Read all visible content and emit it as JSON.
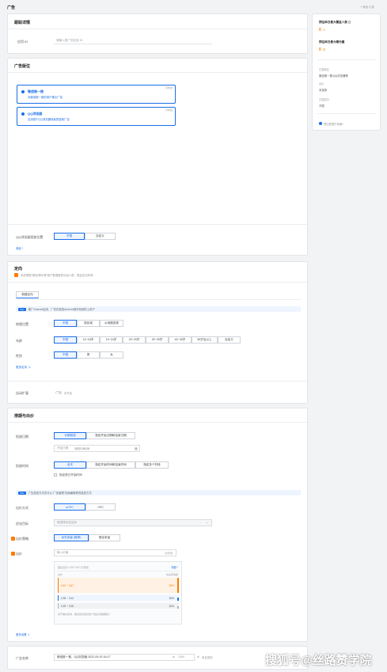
{
  "page": {
    "title": "广告",
    "top_link": "+ 添加 计划"
  },
  "tracking": {
    "header": "跟踪详情",
    "app_id_label": "应用 ID",
    "app_id_placeholder": "请输入推广的应用 ID"
  },
  "placement": {
    "header": "广告版位",
    "options": [
      {
        "badge": "可修改",
        "title": "微信推一推",
        "desc": "向使用推一推的用户展示广告"
      },
      {
        "badge": "可修改",
        "title": "QQ浏览器",
        "desc": "支持基于QQ浏览器场景的搜索广告"
      }
    ],
    "qqb_label": "QQ浏览器投放位置",
    "qqb_options": [
      "不限",
      "自定义"
    ],
    "collapse_link": "收起 ^"
  },
  "targeting": {
    "header": "定向",
    "notice": "系统根据“微信/腾讯等”账户数据推荐合适人群，提高定向效率。",
    "new_tab": "新建定向",
    "tip_tag": "Tips",
    "tip_text": "推广Android应用，广告仅投放Android操作系统的上用户",
    "location_label": "地理位置",
    "location_options": [
      "不限",
      "按区域",
      "从地图选择"
    ],
    "age_label": "年龄",
    "age_options": [
      "不限",
      "14~18岁",
      "19~24岁",
      "25~29岁",
      "30~39岁",
      "40~49岁",
      "50岁及以上",
      "自定义"
    ],
    "gender_label": "性别",
    "gender_options": [
      "不限",
      "男",
      "女"
    ],
    "more_link": "更多定向 ≫",
    "auto_expand_label": "自动扩量",
    "auto_expand_state": "未开启"
  },
  "bidding": {
    "header": "排期与出价",
    "date_label": "投放日期",
    "date_options": [
      "长期投放",
      "指定开始日期和结束日期"
    ],
    "start_placeholder": "开始日期",
    "start_value": "2022-09-29",
    "time_label": "投放时间",
    "time_options": [
      "全天",
      "指定开始时间和结束时间",
      "指定多个时段"
    ],
    "specify_start_label": "指定首日开始时间",
    "tip_tag": "Tips",
    "tip_text": "广告投放方式仅可从“广告管理”页面编辑修改投放方式",
    "method_label": "出价方式",
    "method_options": [
      "oCPC",
      "CPC"
    ],
    "goal_label": "优化目标",
    "goal_placeholder": "请选择优化目标",
    "strategy_label": "出价策略",
    "strategy_options": [
      "优先拿量 (推荐)",
      "稳定拿量"
    ],
    "bid_label": "出价",
    "bid_placeholder": "输入价格",
    "bid_unit": "元/优化",
    "suggestion": {
      "head": "建议出价 0.39~0.67 元/优化",
      "expand": "详细 ^",
      "col_left": "出价",
      "col_right": "优先获得量",
      "rows": [
        {
          "range": "0.42 ~ 0.67",
          "pct": "50%",
          "share": 0.5,
          "color": "#ff7a00"
        },
        {
          "range": "0.35 ~ 0.42",
          "pct": "30%",
          "share": 0.3,
          "color": "#1a6ee6"
        },
        {
          "range": "0.29 ~ 0.35",
          "pct": "20%",
          "share": 0.2,
          "color": "#aab4c0"
        }
      ],
      "foot": "基于相似定向、相近优化目标的广告出价数据统计"
    },
    "more_settings": "更多设置 ∨"
  },
  "ad_name": {
    "label": "广告名称",
    "value": "微信推一推、QQ浏览器-2022-09-29 16:17",
    "counter": "21/60",
    "extra": "命名规则"
  },
  "sidebar": {
    "reach_title": "预估单日最大覆盖人数",
    "reach_value": "0",
    "reach_unit": "人",
    "exposure_title": "预估单日最大曝光量",
    "exposure_value": "0",
    "exposure_unit": "次",
    "section1_label": "已选版位",
    "section1_value": "微信推一推/QQ浏览器等",
    "section2_label": "出价",
    "section2_value": "未选择",
    "section3_label": "已选定向",
    "section3_value": "不限",
    "feedback": "预估数据不准确?"
  },
  "watermark": "搜狐号@丝路赞学院"
}
